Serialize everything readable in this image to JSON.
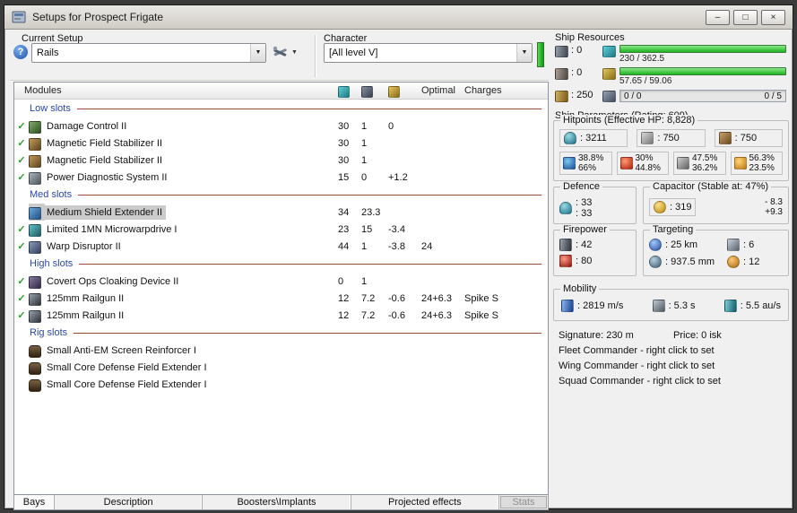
{
  "window": {
    "title": "Setups for Prospect Frigate",
    "minimize_glyph": "–",
    "maximize_glyph": "□",
    "close_glyph": "×"
  },
  "icons": {
    "dropdown": "▼"
  },
  "setup": {
    "label": "Current Setup",
    "help_glyph": "?",
    "value": "Rails"
  },
  "character": {
    "label": "Character",
    "value": "[All level V]"
  },
  "resources": {
    "title": "Ship Resources",
    "turrets": ": 0",
    "launchers": ": 0",
    "calibration": ": 250",
    "cpu": "230 / 362.5",
    "powergrid": "57.65 / 59.06",
    "dronebay": "0 / 0",
    "bandwidth": "0 / 5"
  },
  "modules": {
    "header": {
      "title": "Modules",
      "optimal": "Optimal",
      "charges": "Charges"
    },
    "sections": [
      {
        "title": "Low slots",
        "rows": [
          {
            "check": "✓",
            "name": "Damage Control II",
            "cpu": "30",
            "pg": "1",
            "cap": "0",
            "optimal": "",
            "charges": ""
          },
          {
            "check": "✓",
            "name": "Magnetic Field Stabilizer II",
            "cpu": "30",
            "pg": "1",
            "cap": "",
            "optimal": "",
            "charges": ""
          },
          {
            "check": "✓",
            "name": "Magnetic Field Stabilizer II",
            "cpu": "30",
            "pg": "1",
            "cap": "",
            "optimal": "",
            "charges": ""
          },
          {
            "check": "✓",
            "name": "Power Diagnostic System II",
            "cpu": "15",
            "pg": "0",
            "cap": "+1.2",
            "optimal": "",
            "charges": ""
          }
        ]
      },
      {
        "title": "Med slots",
        "rows": [
          {
            "check": "",
            "name": "Medium Shield Extender II",
            "cpu": "34",
            "pg": "23.3",
            "cap": "",
            "optimal": "",
            "charges": ""
          },
          {
            "check": "✓",
            "name": "Limited 1MN Microwarpdrive I",
            "cpu": "23",
            "pg": "15",
            "cap": "-3.4",
            "optimal": "",
            "charges": ""
          },
          {
            "check": "✓",
            "name": "Warp Disruptor II",
            "cpu": "44",
            "pg": "1",
            "cap": "-3.8",
            "optimal": "24",
            "charges": ""
          }
        ]
      },
      {
        "title": "High slots",
        "rows": [
          {
            "check": "✓",
            "name": "Covert Ops Cloaking Device II",
            "cpu": "0",
            "pg": "1",
            "cap": "",
            "optimal": "",
            "charges": ""
          },
          {
            "check": "✓",
            "name": "125mm Railgun II",
            "cpu": "12",
            "pg": "7.2",
            "cap": "-0.6",
            "optimal": "24+6.3",
            "charges": "Spike S"
          },
          {
            "check": "✓",
            "name": "125mm Railgun II",
            "cpu": "12",
            "pg": "7.2",
            "cap": "-0.6",
            "optimal": "24+6.3",
            "charges": "Spike S"
          }
        ]
      },
      {
        "title": "Rig slots",
        "rows": [
          {
            "check": "",
            "name": "Small Anti-EM Screen Reinforcer I",
            "cpu": "",
            "pg": "",
            "cap": "",
            "optimal": "",
            "charges": ""
          },
          {
            "check": "",
            "name": "Small Core Defense Field Extender I",
            "cpu": "",
            "pg": "",
            "cap": "",
            "optimal": "",
            "charges": ""
          },
          {
            "check": "",
            "name": "Small Core Defense Field Extender I",
            "cpu": "",
            "pg": "",
            "cap": "",
            "optimal": "",
            "charges": ""
          }
        ]
      }
    ]
  },
  "parameters": {
    "title": "Ship Parameters (Rating: 609)",
    "hitpoints": {
      "title": "Hitpoints (Effective HP: 8,828)",
      "shield": ": 3211",
      "armor": ": 750",
      "hull": ": 750",
      "resists": [
        {
          "shield": "38.8%",
          "armor": "66%"
        },
        {
          "shield": "30%",
          "armor": "44.8%"
        },
        {
          "shield": "47.5%",
          "armor": "36.2%"
        },
        {
          "shield": "56.3%",
          "armor": "23.5%"
        }
      ]
    },
    "defence": {
      "title": "Defence",
      "value1": ": 33",
      "value2": ": 33"
    },
    "capacitor": {
      "title": "Capacitor (Stable at: 47%)",
      "amount": ": 319",
      "drain": "- 8.3",
      "recharge": "+9.3"
    },
    "firepower": {
      "title": "Firepower",
      "volley": ": 42",
      "dps": ": 80"
    },
    "targeting": {
      "title": "Targeting",
      "range": ": 25 km",
      "max_targets": ": 6",
      "scan_resolution": ": 937.5 mm",
      "sensor_strength": ": 12"
    },
    "mobility": {
      "title": "Mobility",
      "speed": ": 2819 m/s",
      "align_time": ": 5.3 s",
      "warp_speed": ": 5.5 au/s"
    },
    "signature": "Signature: 230 m",
    "price": "Price: 0 isk",
    "fleet_commander": "Fleet Commander - right click to set",
    "wing_commander": "Wing Commander - right click to set",
    "squad_commander": "Squad Commander - right click to set"
  },
  "tabs": {
    "bays": "Bays",
    "description": "Description",
    "boosters": "Boosters\\Implants",
    "projected": "Projected effects",
    "stats": "Stats"
  }
}
